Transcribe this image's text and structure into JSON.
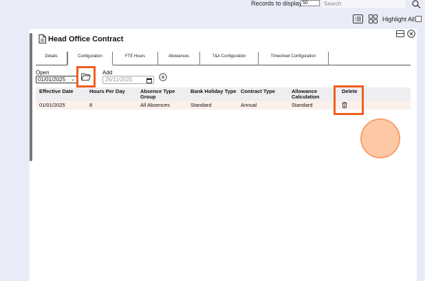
{
  "header": {
    "records_label": "Records to display",
    "records_value": "50",
    "search_placeholder": "Search",
    "highlight_all_label": "Highlight All"
  },
  "page": {
    "title": "Head Office Contract"
  },
  "tabs": [
    {
      "label": "Details",
      "active": false
    },
    {
      "label": "Configuration",
      "active": true
    },
    {
      "label": "FTE Hours",
      "active": false
    },
    {
      "label": "Allowances",
      "active": false
    },
    {
      "label": "T&A Configuration",
      "active": false
    },
    {
      "label": "Timesheet Configuration",
      "active": false
    }
  ],
  "controls": {
    "open_label": "Open",
    "open_value": "01/01/2025",
    "add_label": "Add",
    "add_date_value": "26/11/2025"
  },
  "table": {
    "headers": {
      "effective_date": "Effective Date",
      "hours_per_day": "Hours Per Day",
      "absence_type_group": "Absence Type Group",
      "bank_holiday_type": "Bank Holiday Type",
      "contract_type": "Contract Type",
      "allowance_calculation": "Allowance Calculation",
      "delete": "Delete"
    },
    "rows": [
      {
        "effective_date": "01/01/2025",
        "hours_per_day": "8",
        "absence_type_group": "All Absences",
        "bank_holiday_type": "Standard",
        "contract_type": "Annual",
        "allowance_calculation": "Standard"
      }
    ]
  },
  "colors": {
    "highlight": "#ef5e1c",
    "row_bg": "#fbf0ea",
    "header_bg": "#eeeef0",
    "page_bg": "#e9ebf6"
  },
  "icons": {
    "search": "search-icon",
    "list": "list-view-icon",
    "grid": "grid-view-icon",
    "document": "document-icon",
    "window": "window-icon",
    "close": "close-icon",
    "folder": "folder-open-icon",
    "calendar": "calendar-icon",
    "add": "add-circle-icon",
    "trash": "trash-icon"
  }
}
